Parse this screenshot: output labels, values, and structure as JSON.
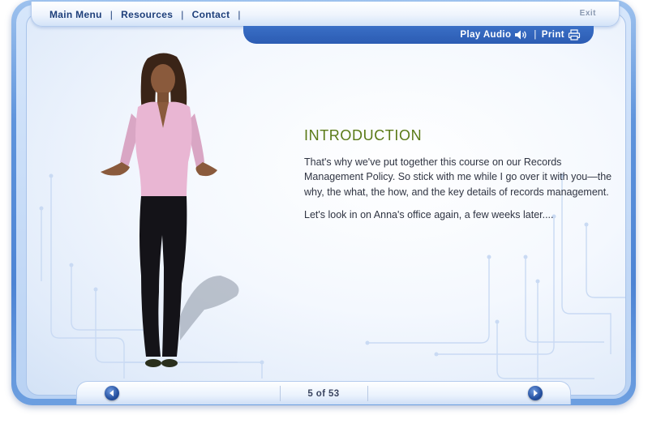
{
  "nav": {
    "main_menu": "Main Menu",
    "resources": "Resources",
    "contact": "Contact",
    "separator": "|",
    "exit": "Exit"
  },
  "utility": {
    "play_audio": "Play Audio",
    "print": "Print",
    "separator": "|",
    "audio_icon": "speaker-icon",
    "print_icon": "printer-icon"
  },
  "content": {
    "heading": "INTRODUCTION",
    "paragraphs": [
      "That's why we've put together this course on our Records Management Policy. So stick with me while I go over it with you—the why, the what, the how, and the key details of records management.",
      "Let's look in on Anna's office again, a few weeks later...."
    ]
  },
  "pager": {
    "label": "5 of 53",
    "current": 5,
    "total": 53,
    "prev_icon": "arrow-left-icon",
    "next_icon": "arrow-right-icon"
  },
  "colors": {
    "heading": "#5a7a16",
    "frame": "#4d84d4",
    "nav_text": "#1e3f7a"
  }
}
